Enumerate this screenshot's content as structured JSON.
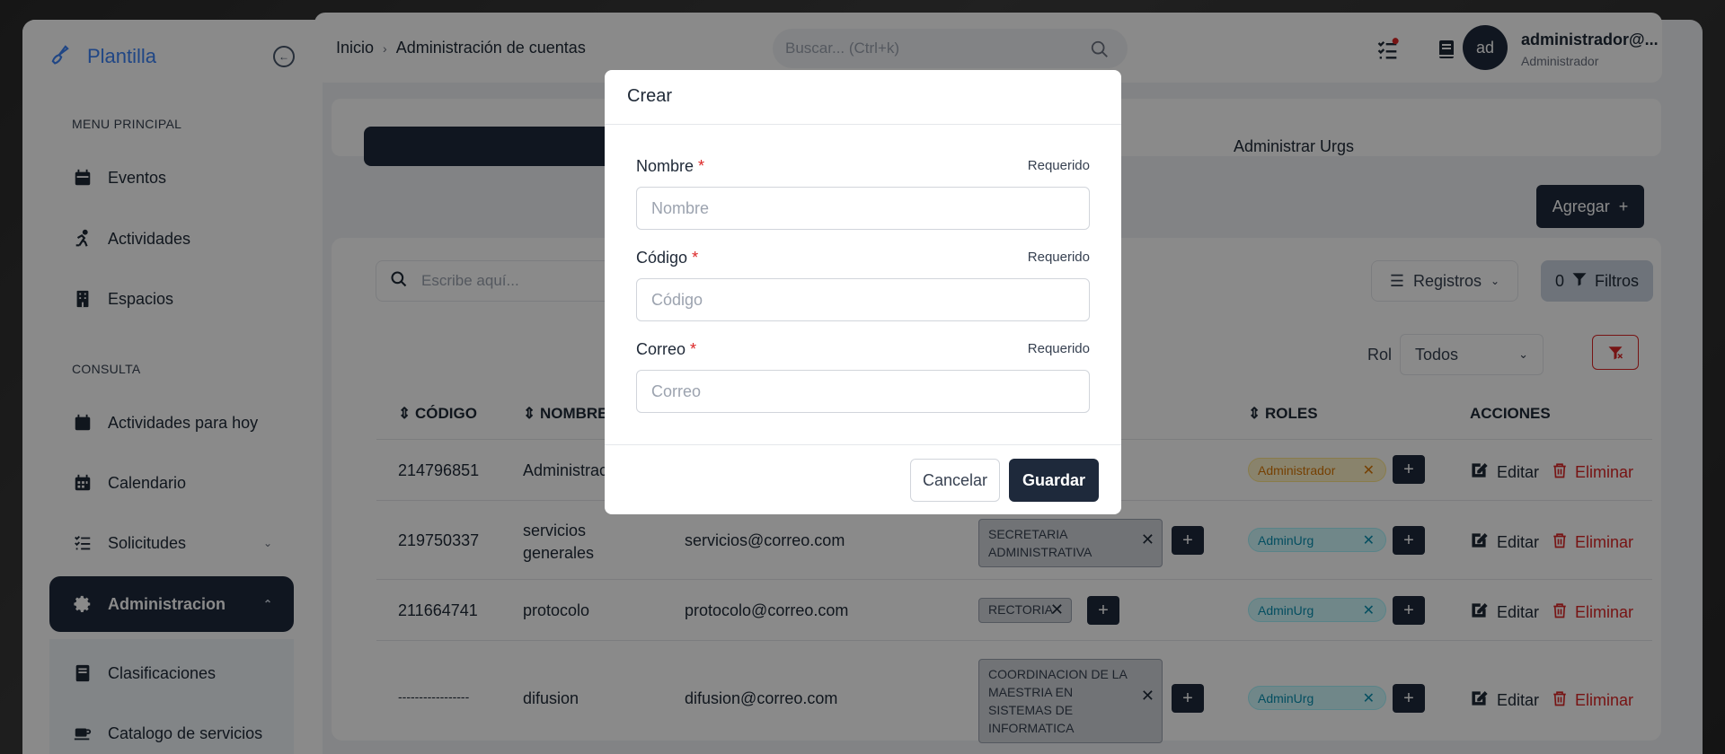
{
  "app": {
    "brand": "Plantilla"
  },
  "sidebar": {
    "section_main": "MENU PRINCIPAL",
    "section_consulta": "CONSULTA",
    "items": [
      {
        "label": "Eventos",
        "icon": "calendar-icon"
      },
      {
        "label": "Actividades",
        "icon": "activity-icon"
      },
      {
        "label": "Espacios",
        "icon": "building-icon"
      },
      {
        "label": "Actividades para hoy",
        "icon": "calendar-today-icon"
      },
      {
        "label": "Calendario",
        "icon": "calendar-grid-icon"
      },
      {
        "label": "Solicitudes",
        "icon": "list-check-icon"
      },
      {
        "label": "Administracion",
        "icon": "gear-icon"
      },
      {
        "label": "Clasificaciones",
        "icon": "book-icon"
      },
      {
        "label": "Catalogo de servicios",
        "icon": "coffee-icon"
      }
    ]
  },
  "header": {
    "breadcrumb": [
      "Inicio",
      "Administración de cuentas"
    ],
    "search_placeholder": "Buscar... (Ctrl+k)",
    "user_initials": "ad",
    "user_name": "administrador@...",
    "user_role": "Administrador"
  },
  "tabs": {
    "second": "Administrar Urgs"
  },
  "toolbar": {
    "add_label": "Agregar",
    "search_placeholder": "Escribe aquí...",
    "records_label": "Registros",
    "filters_count": "0",
    "filters_label": "Filtros",
    "rol_label": "Rol",
    "rol_value": "Todos"
  },
  "table": {
    "headers": [
      "CÓDIGO",
      "NOMBRE",
      "ROLES",
      "ACCIONES"
    ],
    "edit_label": "Editar",
    "delete_label": "Eliminar",
    "rows": [
      {
        "code": "214796851",
        "name": "Administrac",
        "email": "",
        "dept": "",
        "role": "Administrador"
      },
      {
        "code": "219750337",
        "name": "servicios generales",
        "email": "servicios@correo.com",
        "dept": "SECRETARIA ADMINISTRATIVA",
        "role": "AdminUrg"
      },
      {
        "code": "211664741",
        "name": "protocolo",
        "email": "protocolo@correo.com",
        "dept": "RECTORIA",
        "role": "AdminUrg"
      },
      {
        "code": "-----------------",
        "name": "difusion",
        "email": "difusion@correo.com",
        "dept": "COORDINACION DE LA MAESTRIA EN SISTEMAS DE INFORMATICA",
        "role": "AdminUrg"
      }
    ]
  },
  "modal": {
    "title": "Crear",
    "required_label": "Requerido",
    "fields": [
      {
        "label": "Nombre",
        "placeholder": "Nombre",
        "value": ""
      },
      {
        "label": "Código",
        "placeholder": "Código",
        "value": ""
      },
      {
        "label": "Correo",
        "placeholder": "Correo",
        "value": ""
      }
    ],
    "cancel_label": "Cancelar",
    "save_label": "Guardar"
  },
  "colors": {
    "primary": "#1e293b",
    "accent": "#3b82f6",
    "danger": "#dc2626",
    "admin_role": "#d97706",
    "urg_role": "#0891b2"
  }
}
